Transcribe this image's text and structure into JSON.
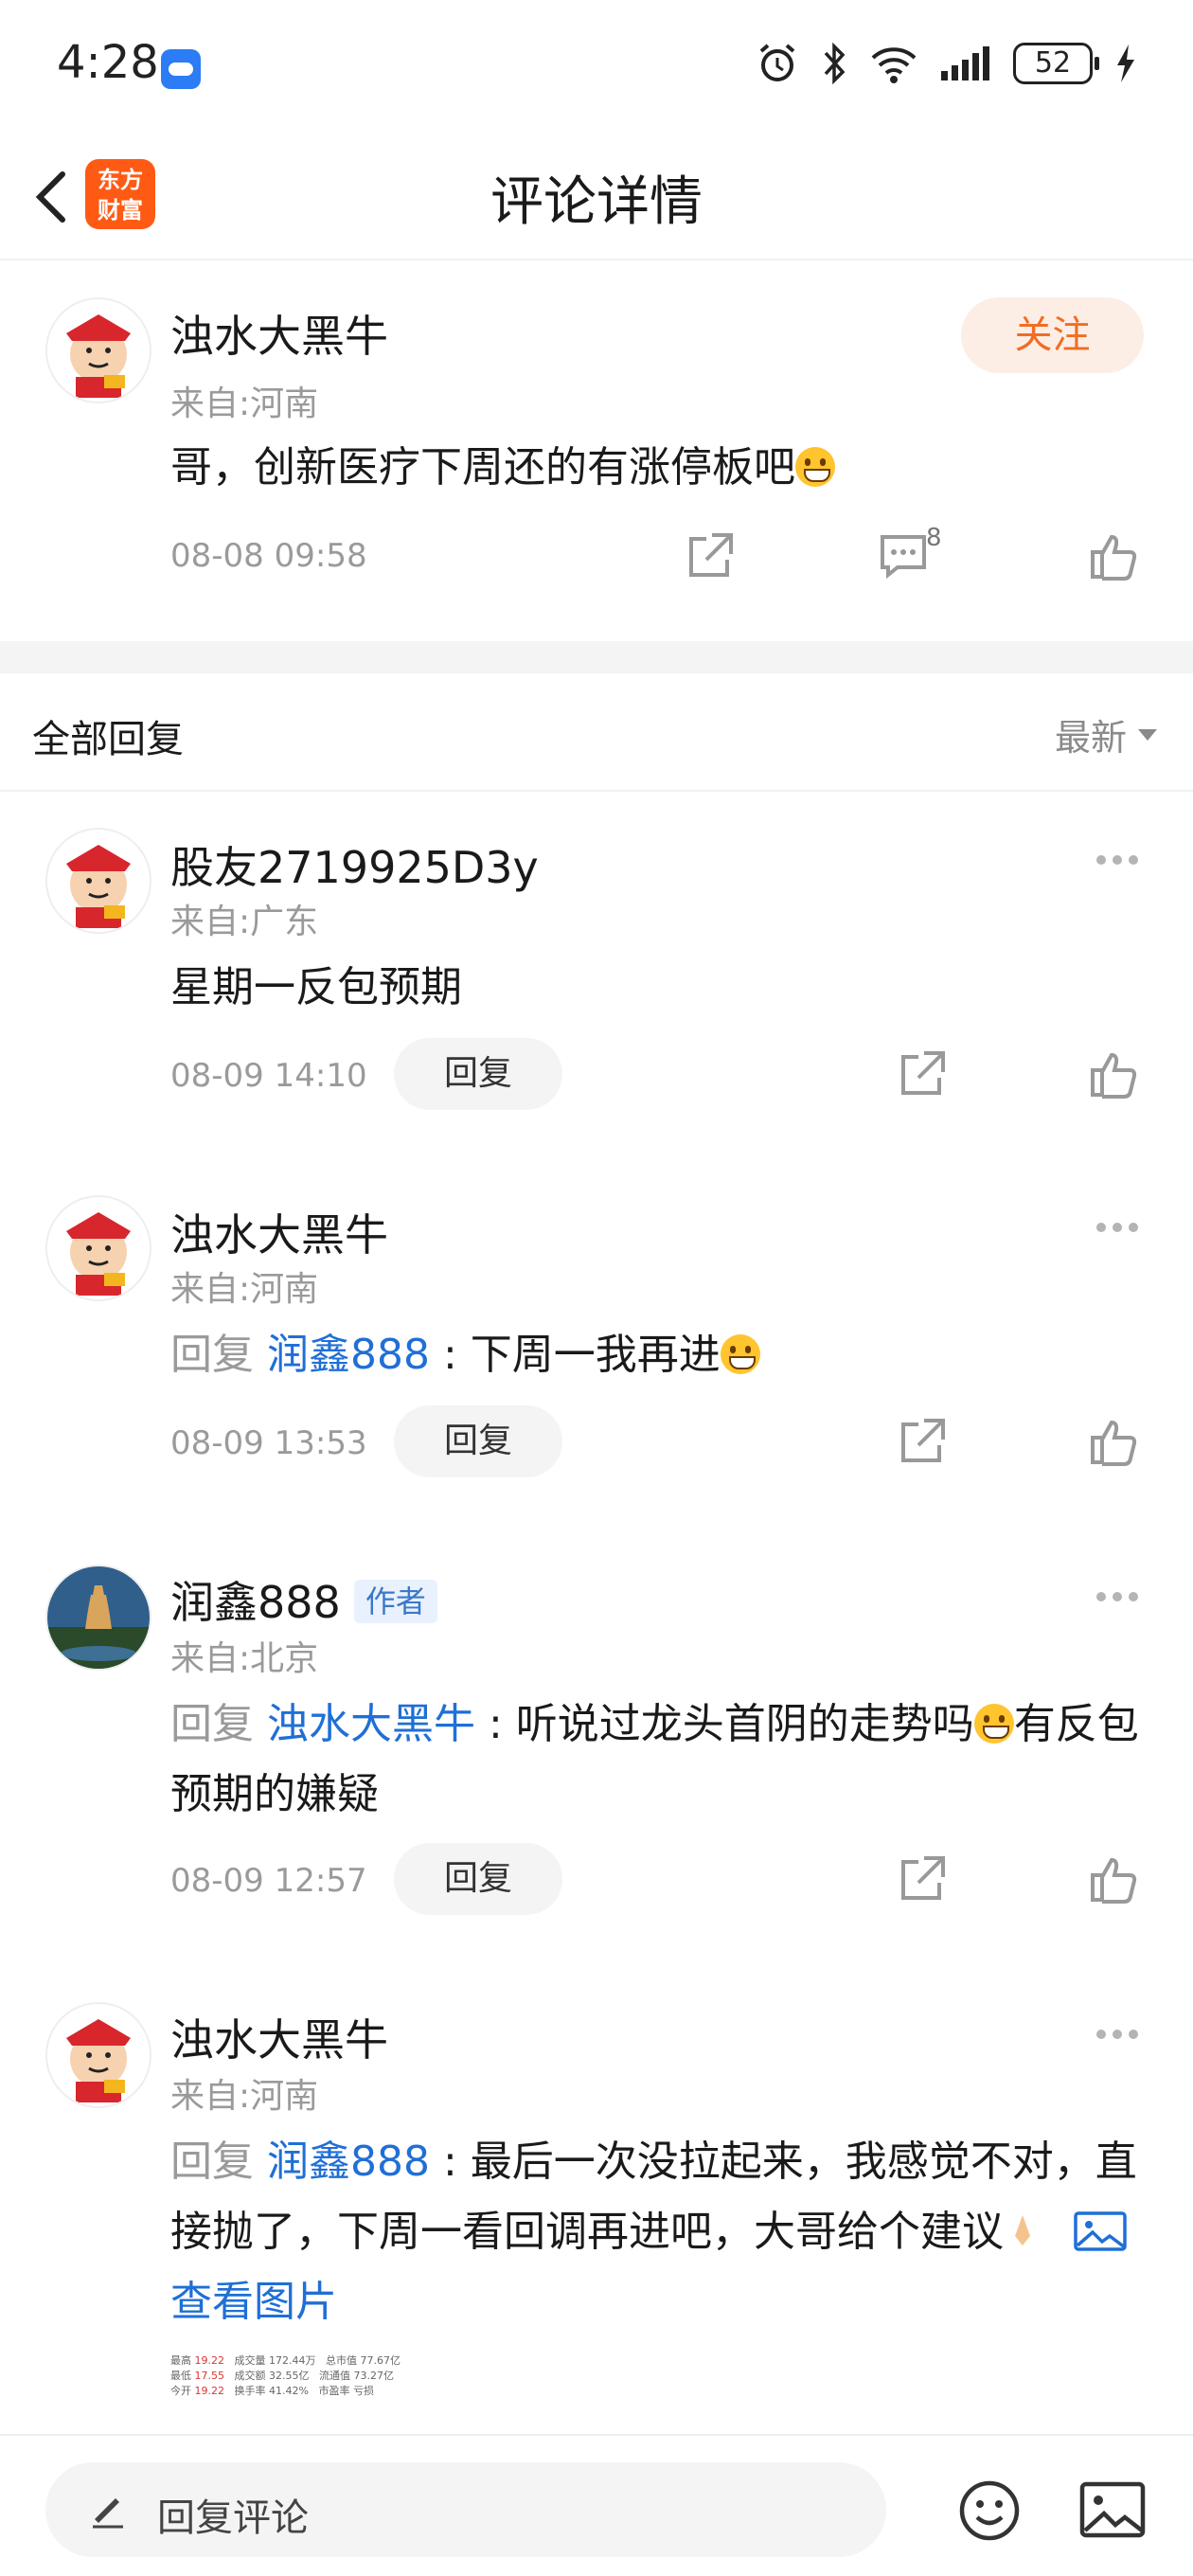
{
  "status_bar": {
    "time": "4:28",
    "battery": "52"
  },
  "header": {
    "title": "评论详情",
    "logo_text_1": "东方",
    "logo_text_2": "财富"
  },
  "post": {
    "username": "浊水大黑牛",
    "location": "来自:河南",
    "follow_label": "关注",
    "content": "哥，创新医疗下周还的有涨停板吧",
    "time": "08-08 09:58",
    "comment_count": "8"
  },
  "replies_section": {
    "title": "全部回复",
    "sort_label": "最新"
  },
  "replies": [
    {
      "username": "股友2719925D3y",
      "location": "来自:广东",
      "text": "星期一反包预期",
      "time": "08-09 14:10",
      "reply_label": "回复"
    },
    {
      "username": "浊水大黑牛",
      "location": "来自:河南",
      "reply_prefix": "回复",
      "mention": "润鑫888",
      "text": ": 下周一我再进",
      "time": "08-09 13:53",
      "reply_label": "回复"
    },
    {
      "username": "润鑫888",
      "author_tag": "作者",
      "location": "来自:北京",
      "reply_prefix": "回复",
      "mention": "浊水大黑牛",
      "text_1": ": 听说过龙头首阴的走势吗",
      "text_2": "有反包预期的嫌疑",
      "time": "08-09 12:57",
      "reply_label": "回复"
    },
    {
      "username": "浊水大黑牛",
      "location": "来自:河南",
      "reply_prefix": "回复",
      "mention": "润鑫888",
      "text_1": ": 最后一次没拉起来，我感觉不对，直接抛了，下周一看回调再进吧，大哥给个建议",
      "view_image": "查看图片"
    }
  ],
  "thumbnail": {
    "r1": [
      "最高",
      "19.22",
      "成交量",
      "172.44万",
      "总市值",
      "77.67亿"
    ],
    "r2": [
      "最低",
      "17.55",
      "成交额",
      "32.55亿",
      "流通值",
      "73.27亿"
    ],
    "r3": [
      "今开",
      "19.22",
      "换手率",
      "41.42%",
      "市盈率",
      "亏损"
    ]
  },
  "bottom_bar": {
    "placeholder": "回复评论"
  },
  "colors": {
    "brand": "#ff5a14",
    "follow_text": "#f06d24",
    "link": "#1f6fd6",
    "muted": "#9a9a9a"
  }
}
